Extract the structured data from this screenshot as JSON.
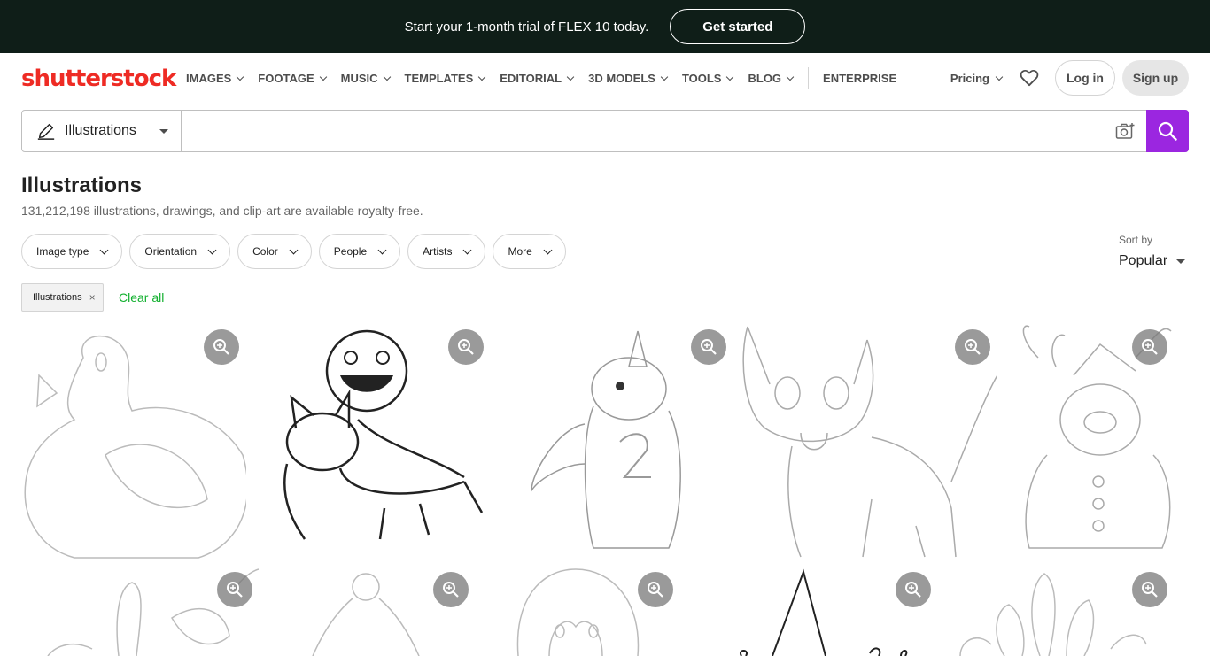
{
  "promo": {
    "text": "Start your 1-month trial of FLEX 10 today.",
    "button": "Get started"
  },
  "logo": {
    "text": "shutterstock",
    "color": "#ee2b24"
  },
  "nav": {
    "items": [
      "IMAGES",
      "FOOTAGE",
      "MUSIC",
      "TEMPLATES",
      "EDITORIAL",
      "3D MODELS",
      "TOOLS",
      "BLOG"
    ],
    "enterprise": "ENTERPRISE",
    "pricing": "Pricing",
    "login": "Log in",
    "signup": "Sign up"
  },
  "search": {
    "type": "Illustrations",
    "query": "",
    "accent": "#9b26e0"
  },
  "page": {
    "title": "Illustrations",
    "subtitle": "131,212,198 illustrations, drawings, and clip-art are available royalty-free."
  },
  "filters": [
    "Image type",
    "Orientation",
    "Color",
    "People",
    "Artists",
    "More"
  ],
  "sort": {
    "label": "Sort by",
    "value": "Popular"
  },
  "active_chips": [
    {
      "label": "Illustrations",
      "remove": "×"
    }
  ],
  "clear_all": "Clear all",
  "clear_all_color": "#12b02f",
  "gallery": [
    {
      "subject": "duck outline"
    },
    {
      "subject": "monster riding cat and dog"
    },
    {
      "subject": "unicorn holding number 2"
    },
    {
      "subject": "cat outline"
    },
    {
      "subject": "reindeer snowman"
    },
    {
      "subject": "snail flower"
    },
    {
      "subject": "santa hat"
    },
    {
      "subject": "penguin"
    },
    {
      "subject": "gnome hat"
    },
    {
      "subject": "flower petals"
    }
  ]
}
